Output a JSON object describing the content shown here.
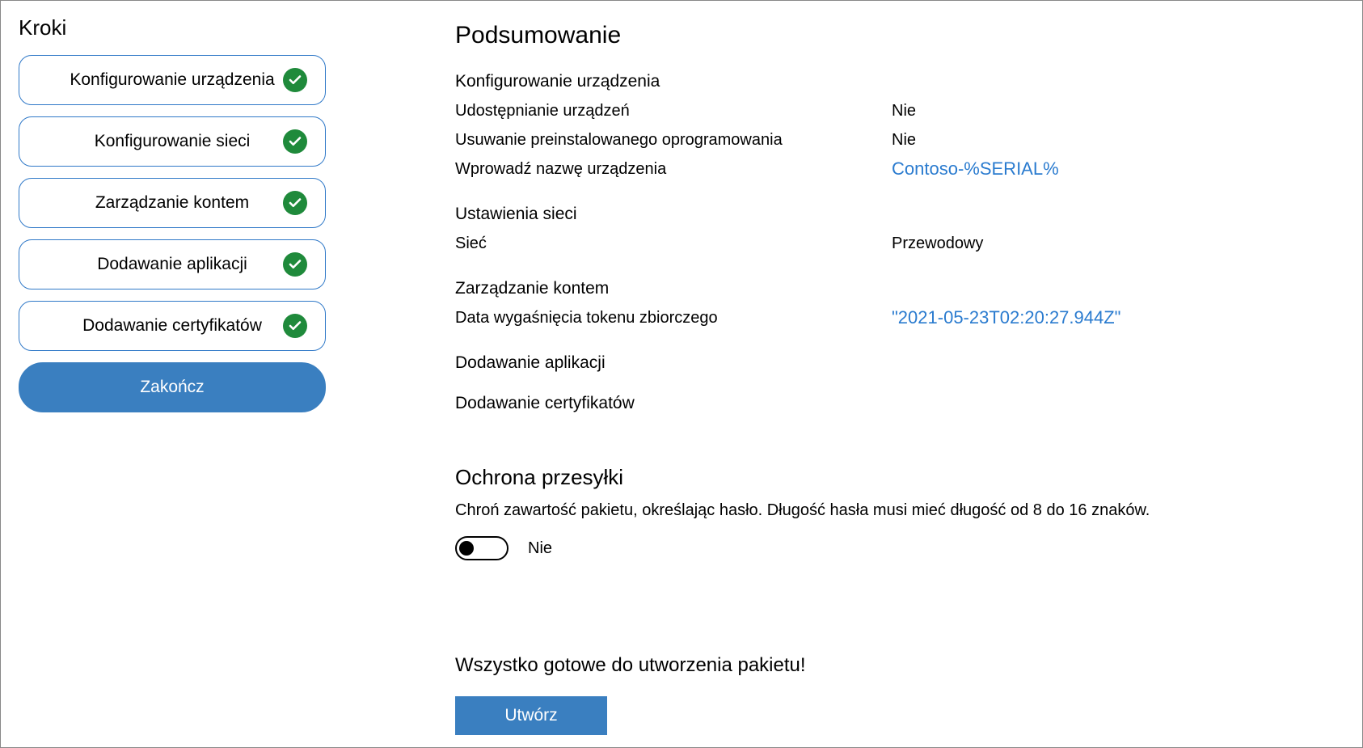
{
  "sidebar": {
    "title": "Kroki",
    "steps": [
      {
        "label": "Konfigurowanie urządzenia"
      },
      {
        "label": "Konfigurowanie sieci"
      },
      {
        "label": "Zarządzanie kontem"
      },
      {
        "label": "Dodawanie aplikacji"
      },
      {
        "label": "Dodawanie certyfikatów"
      }
    ],
    "finish_label": "Zakończ"
  },
  "main": {
    "title": "Podsumowanie",
    "device": {
      "heading": "Konfigurowanie urządzenia",
      "share_label": "Udostępnianie urządzeń",
      "share_value": "Nie",
      "remove_label": "Usuwanie preinstalowanego oprogramowania",
      "remove_value": "Nie",
      "name_label": "Wprowadź nazwę urządzenia",
      "name_value": "Contoso-%SERIAL%"
    },
    "network": {
      "heading": "Ustawienia sieci",
      "net_label": "Sieć",
      "net_value": "Przewodowy"
    },
    "account": {
      "heading": "Zarządzanie kontem",
      "token_label": "Data wygaśnięcia tokenu zbiorczego",
      "token_value": "\"2021-05-23T02:20:27.944Z\""
    },
    "apps": {
      "heading": "Dodawanie aplikacji"
    },
    "certs": {
      "heading": "Dodawanie certyfikatów"
    },
    "protection": {
      "heading": "Ochrona przesyłki",
      "desc": "Chroń zawartość pakietu, określając hasło. Długość hasła musi mieć długość od 8 do 16 znaków.",
      "toggle_label": "Nie"
    },
    "ready_text": "Wszystko gotowe do utworzenia pakietu!",
    "create_label": "Utwórz"
  }
}
